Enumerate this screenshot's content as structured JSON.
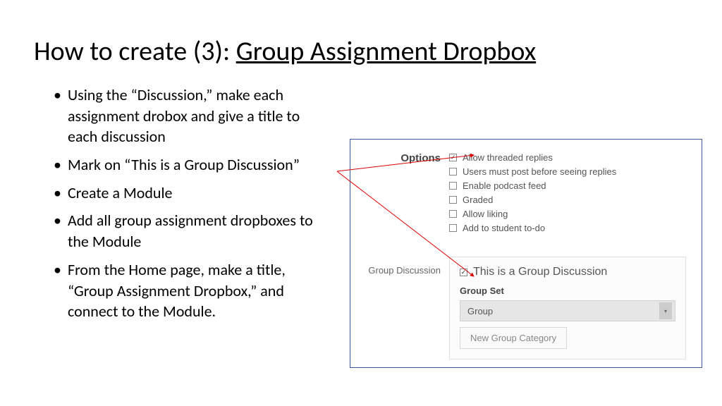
{
  "title": {
    "prefix": "How to create (3): ",
    "underlined": "Group Assignment Dropbox"
  },
  "bullets": [
    "Using the “Discussion,” make each assignment drobox and give a title to each discussion",
    "Mark on “This is a Group Discussion”",
    "Create a Module",
    "Add all group assignment dropboxes to the Module",
    "From the Home page, make a title, “Group Assignment Dropbox,” and connect to the Module."
  ],
  "panel": {
    "options_label": "Options",
    "options": [
      {
        "label": "Allow threaded replies",
        "checked": true
      },
      {
        "label": "Users must post before seeing replies",
        "checked": false
      },
      {
        "label": "Enable podcast feed",
        "checked": false
      },
      {
        "label": "Graded",
        "checked": false
      },
      {
        "label": "Allow liking",
        "checked": false
      },
      {
        "label": "Add to student to-do",
        "checked": false
      }
    ],
    "group_discussion_label": "Group Discussion",
    "group_checkbox_label": "This is a Group Discussion",
    "group_checkbox_checked": true,
    "group_set_label": "Group Set",
    "dropdown_value": "Group",
    "new_group_button": "New Group Category"
  }
}
